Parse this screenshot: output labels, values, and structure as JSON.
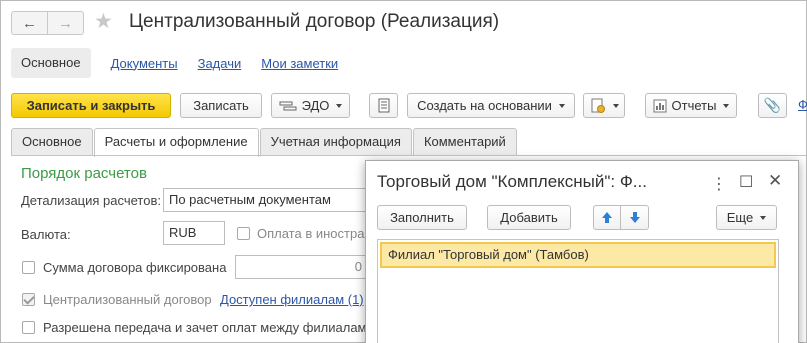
{
  "window": {
    "title": "Централизованный договор (Реализация)",
    "nav_back": "←",
    "nav_forward": "→",
    "favorite_icon": "star-icon"
  },
  "section_nav": {
    "items": [
      {
        "label": "Основное",
        "active": true
      },
      {
        "label": "Документы"
      },
      {
        "label": "Задачи"
      },
      {
        "label": "Мои заметки"
      }
    ]
  },
  "toolbar": {
    "save_close": "Записать и закрыть",
    "save": "Записать",
    "edo": "ЭДО",
    "create_based_on": "Создать на основании",
    "reports": "Отчеты",
    "more_link": "Ф"
  },
  "tabs": [
    {
      "label": "Основное"
    },
    {
      "label": "Расчеты и оформление",
      "active": true
    },
    {
      "label": "Учетная информация"
    },
    {
      "label": "Комментарий"
    }
  ],
  "form": {
    "group_title": "Порядок расчетов",
    "detail_label": "Детализация расчетов:",
    "detail_value": "По расчетным документам",
    "currency_label": "Валюта:",
    "currency_value": "RUB",
    "foreign_payment_label": "Оплата в иностра",
    "fixed_sum_label": "Сумма договора фиксирована",
    "fixed_sum_value": "0",
    "centralized_label": "Централизованный договор",
    "centralized_checked": true,
    "branches_link": "Доступен филиалам (1)",
    "transfer_label": "Разрешена передача и зачет оплат между филиалами"
  },
  "popup": {
    "title": "Торговый дом \"Комплексный\": Ф...",
    "fill_button": "Заполнить",
    "add_button": "Добавить",
    "more_button": "Еще",
    "rows": [
      {
        "label": "Филиал \"Торговый дом\" (Тамбов)",
        "selected": true
      }
    ]
  },
  "colors": {
    "primary_button": "#f4c800",
    "group_title": "#3b9c45",
    "link": "#2b56a8",
    "selected_row": "#fbe9a5",
    "arrow_blue": "#2f7fd6"
  }
}
